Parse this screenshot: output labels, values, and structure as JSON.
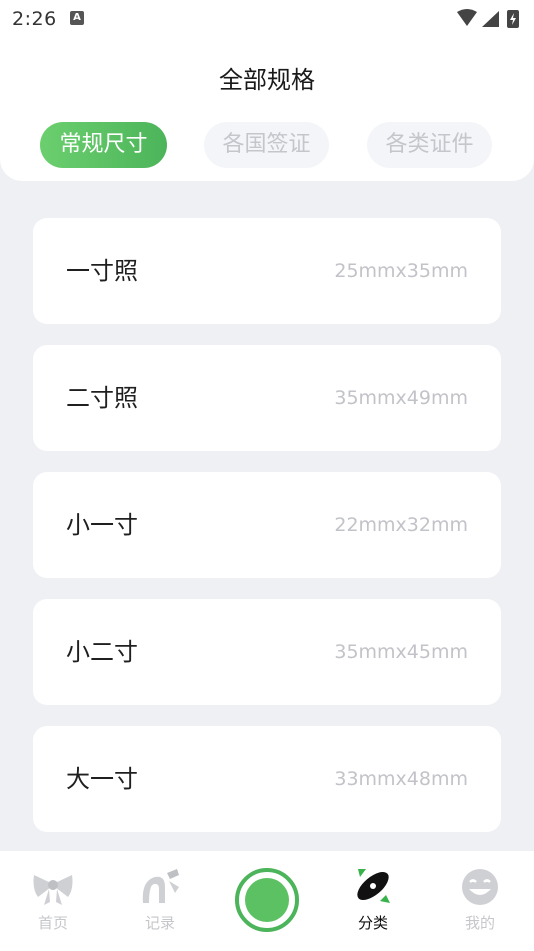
{
  "status_bar": {
    "time": "2:26",
    "notification_icon": "a-icon"
  },
  "header": {
    "title": "全部规格",
    "tabs": [
      {
        "label": "常规尺寸",
        "active": true
      },
      {
        "label": "各国签证",
        "active": false
      },
      {
        "label": "各类证件",
        "active": false
      }
    ]
  },
  "specs": [
    {
      "name": "一寸照",
      "size": "25mmx35mm"
    },
    {
      "name": "二寸照",
      "size": "35mmx49mm"
    },
    {
      "name": "小一寸",
      "size": "22mmx32mm"
    },
    {
      "name": "小二寸",
      "size": "35mmx45mm"
    },
    {
      "name": "大一寸",
      "size": "33mmx48mm"
    }
  ],
  "bottom_nav": {
    "items": [
      {
        "label": "首页",
        "icon": "bow-icon",
        "active": false
      },
      {
        "label": "记录",
        "icon": "record-icon",
        "active": false
      },
      {
        "label": "",
        "icon": "camera-shutter-icon",
        "active": false
      },
      {
        "label": "分类",
        "icon": "category-icon",
        "active": true
      },
      {
        "label": "我的",
        "icon": "profile-face-icon",
        "active": false
      }
    ]
  },
  "colors": {
    "accent": "#5cc162",
    "background": "#eff0f4",
    "inactive_text": "#c4c6cc"
  }
}
